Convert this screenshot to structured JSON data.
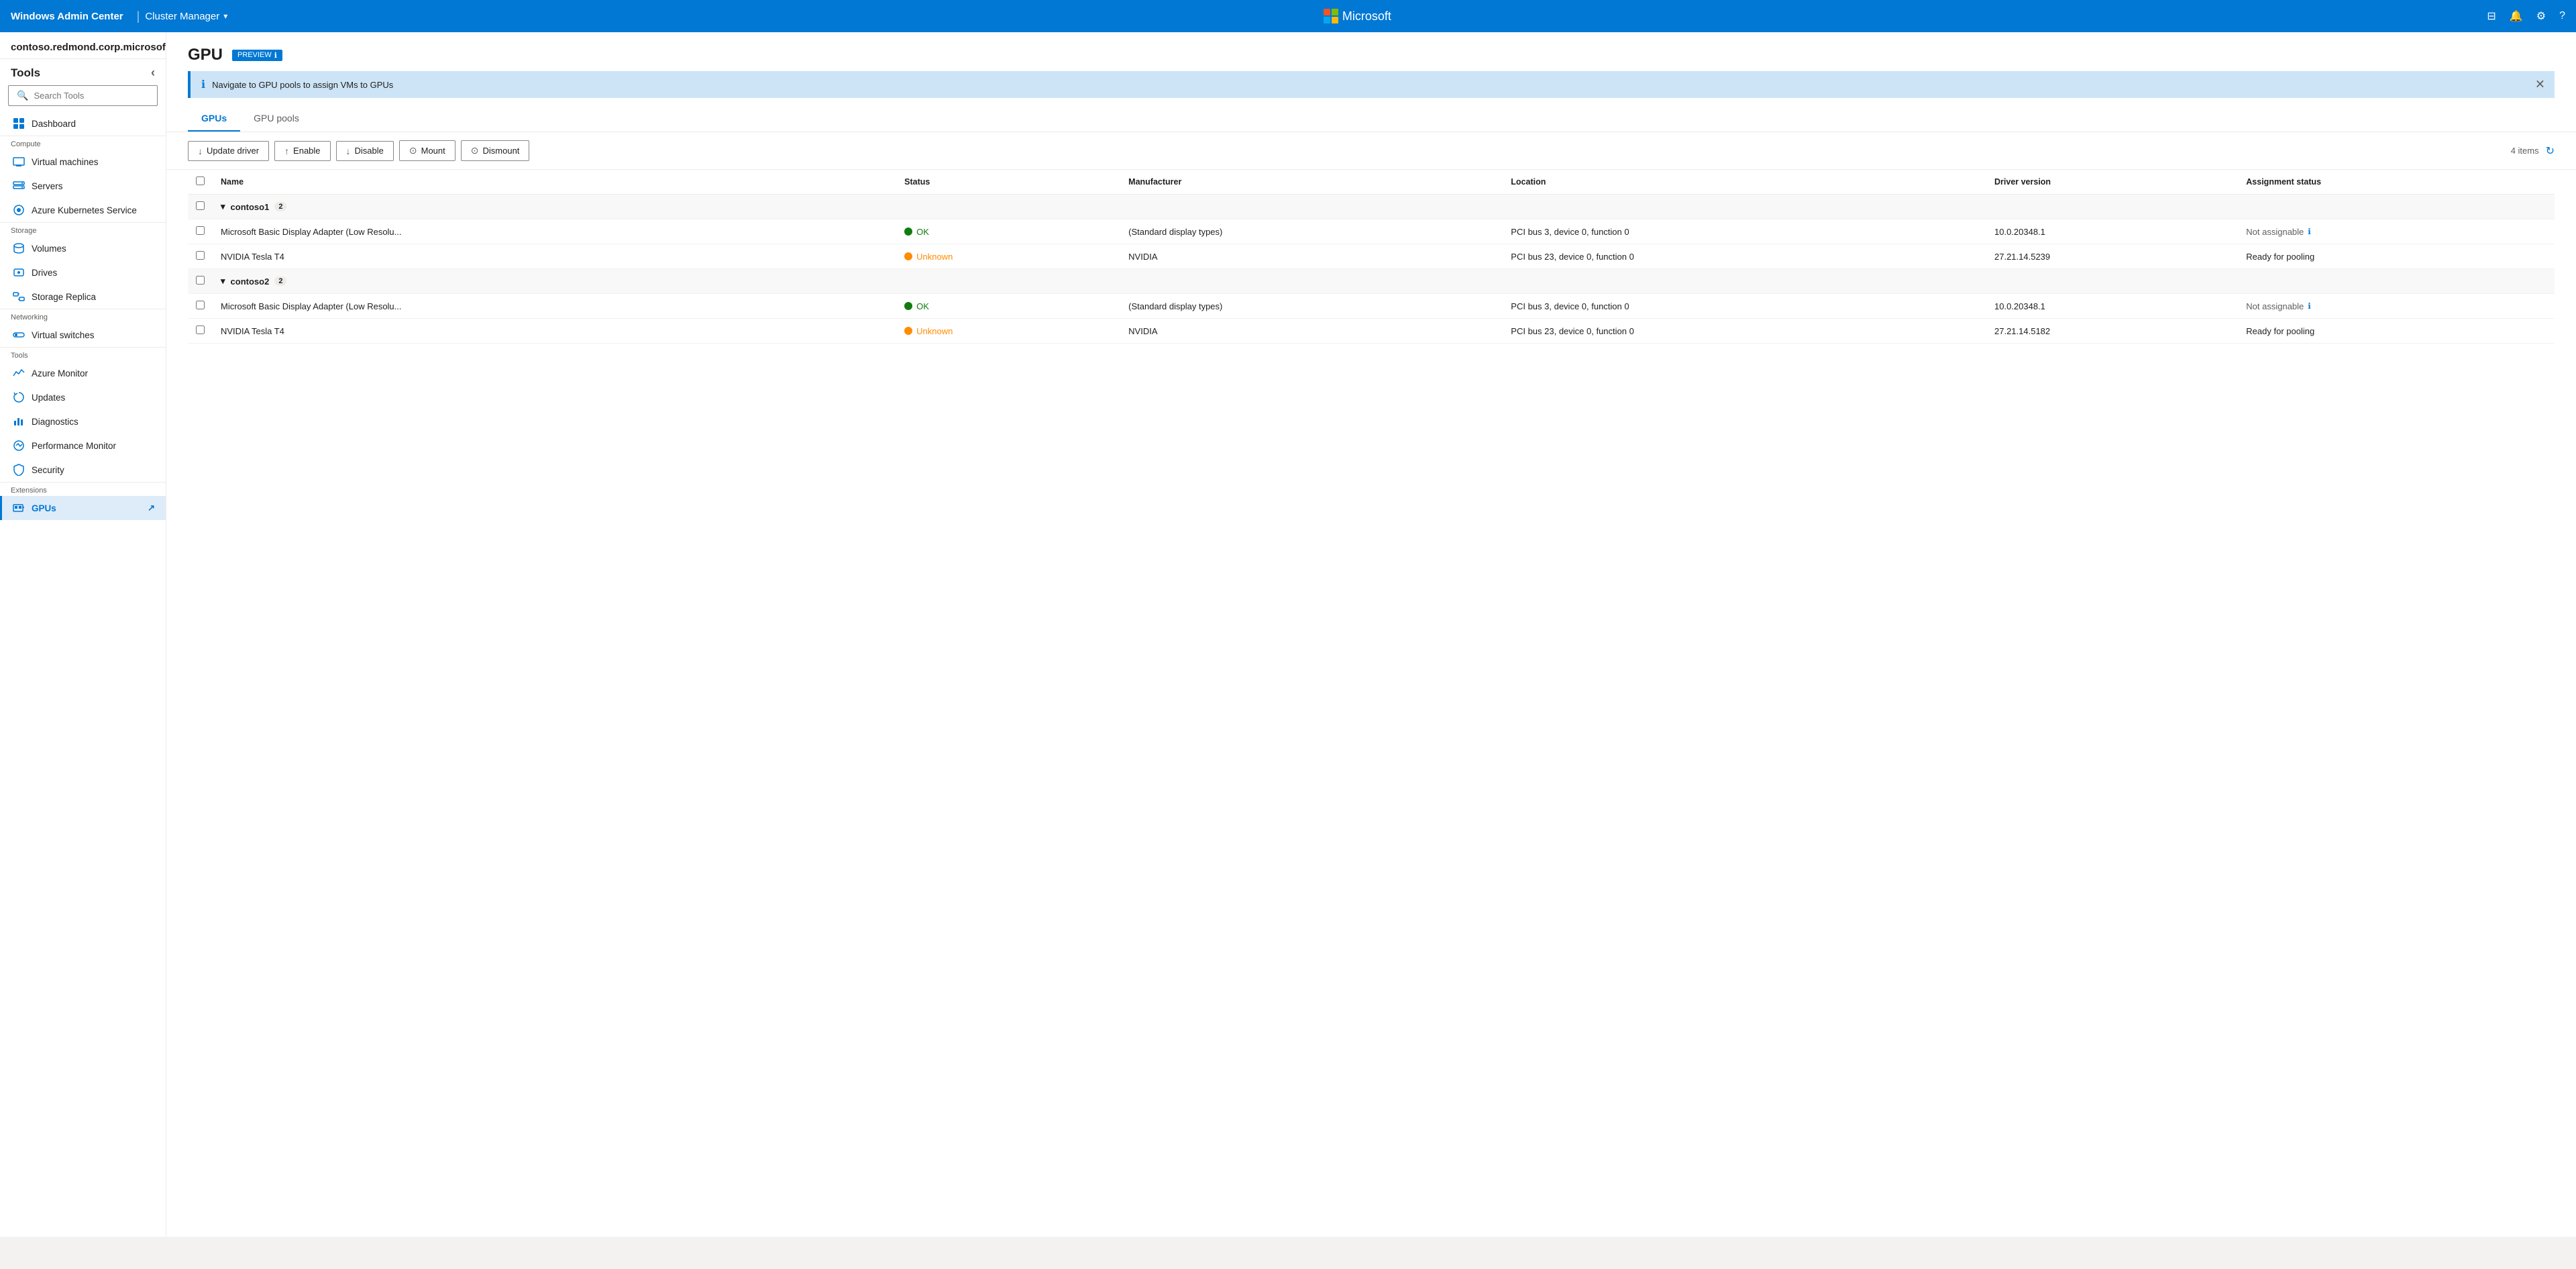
{
  "topbar": {
    "brand": "Windows Admin Center",
    "separator": "|",
    "cluster_label": "Cluster Manager",
    "ms_logo": "Microsoft",
    "icons": [
      "minimize",
      "notifications",
      "settings",
      "help"
    ]
  },
  "domain": "contoso.redmond.corp.microsoft.com",
  "sidebar": {
    "tools_label": "Tools",
    "search_placeholder": "Search Tools",
    "sections": [
      {
        "label": "Compute",
        "items": [
          {
            "name": "Dashboard",
            "id": "dashboard"
          },
          {
            "name": "Virtual machines",
            "id": "virtual-machines"
          },
          {
            "name": "Servers",
            "id": "servers"
          },
          {
            "name": "Azure Kubernetes Service",
            "id": "aks"
          }
        ]
      },
      {
        "label": "Storage",
        "items": [
          {
            "name": "Volumes",
            "id": "volumes"
          },
          {
            "name": "Drives",
            "id": "drives"
          },
          {
            "name": "Storage Replica",
            "id": "storage-replica"
          }
        ]
      },
      {
        "label": "Networking",
        "items": [
          {
            "name": "Virtual switches",
            "id": "virtual-switches"
          }
        ]
      },
      {
        "label": "Tools",
        "items": [
          {
            "name": "Azure Monitor",
            "id": "azure-monitor"
          },
          {
            "name": "Updates",
            "id": "updates"
          },
          {
            "name": "Diagnostics",
            "id": "diagnostics"
          },
          {
            "name": "Performance Monitor",
            "id": "performance-monitor"
          },
          {
            "name": "Security",
            "id": "security"
          }
        ]
      },
      {
        "label": "Extensions",
        "items": [
          {
            "name": "GPUs",
            "id": "gpus",
            "active": true,
            "external": true
          }
        ]
      }
    ]
  },
  "page": {
    "title": "GPU",
    "preview_label": "PREVIEW",
    "preview_info": "ℹ",
    "info_banner": "Navigate to GPU pools to assign VMs to GPUs",
    "tabs": [
      {
        "label": "GPUs",
        "active": true
      },
      {
        "label": "GPU pools",
        "active": false
      }
    ],
    "toolbar": {
      "update_driver": "Update driver",
      "enable": "Enable",
      "disable": "Disable",
      "mount": "Mount",
      "dismount": "Dismount"
    },
    "item_count": "4 items",
    "table": {
      "columns": [
        "Name",
        "Status",
        "Manufacturer",
        "Location",
        "Driver version",
        "Assignment status"
      ],
      "groups": [
        {
          "name": "contoso1",
          "count": 2,
          "rows": [
            {
              "name": "Microsoft Basic Display Adapter (Low Resolu...",
              "status": "OK",
              "status_type": "ok",
              "manufacturer": "(Standard display types)",
              "location": "PCI bus 3, device 0, function 0",
              "driver_version": "10.0.20348.1",
              "assignment_status": "Not assignable",
              "assignment_info": true
            },
            {
              "name": "NVIDIA Tesla T4",
              "status": "Unknown",
              "status_type": "warn",
              "manufacturer": "NVIDIA",
              "location": "PCI bus 23, device 0, function 0",
              "driver_version": "27.21.14.5239",
              "assignment_status": "Ready for pooling",
              "assignment_info": false
            }
          ]
        },
        {
          "name": "contoso2",
          "count": 2,
          "rows": [
            {
              "name": "Microsoft Basic Display Adapter (Low Resolu...",
              "status": "OK",
              "status_type": "ok",
              "manufacturer": "(Standard display types)",
              "location": "PCI bus 3, device 0, function 0",
              "driver_version": "10.0.20348.1",
              "assignment_status": "Not assignable",
              "assignment_info": true
            },
            {
              "name": "NVIDIA Tesla T4",
              "status": "Unknown",
              "status_type": "warn",
              "manufacturer": "NVIDIA",
              "location": "PCI bus 23, device 0, function 0",
              "driver_version": "27.21.14.5182",
              "assignment_status": "Ready for pooling",
              "assignment_info": false
            }
          ]
        }
      ]
    }
  }
}
